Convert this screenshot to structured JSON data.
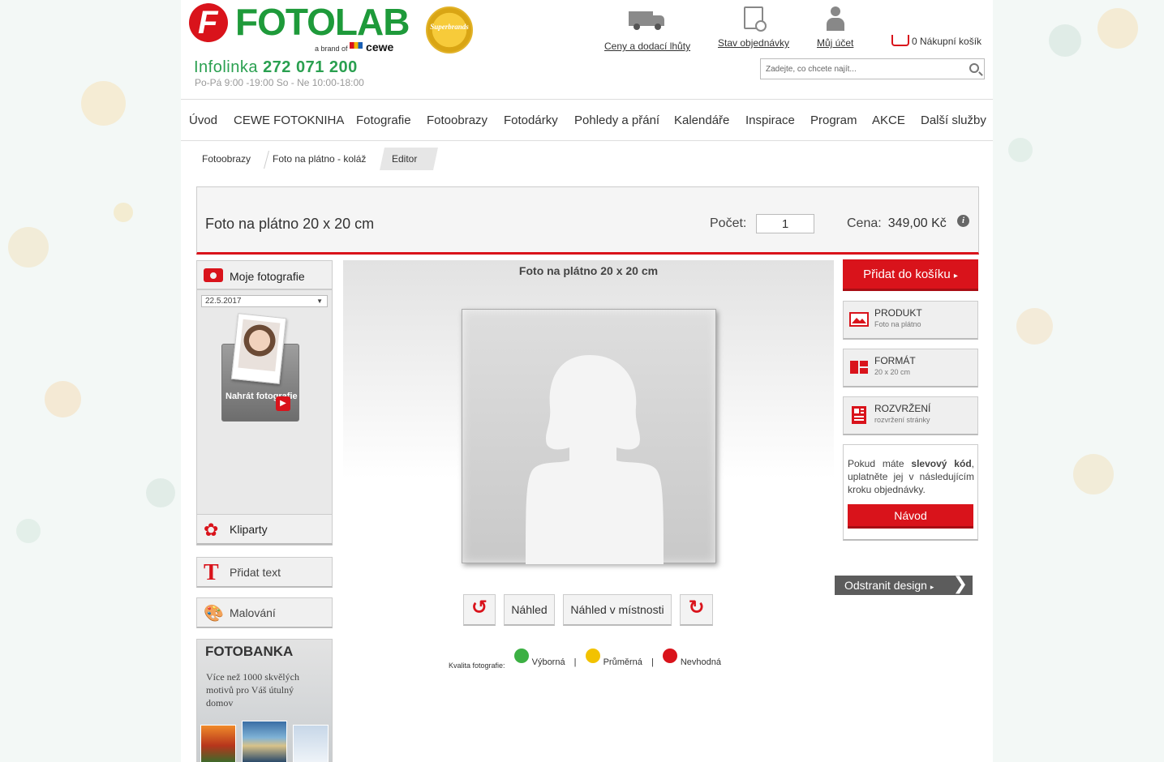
{
  "header": {
    "logo_text": "FOTOLAB",
    "logo_letter": "F",
    "brand_prefix": "a brand of",
    "brand_name": "cewe",
    "award_text": "Superbrands",
    "hotline_label": "Infolinka",
    "hotline_number": "272 071 200",
    "hours": "Po-Pá 9:00 -19:00  So - Ne 10:00-18:00",
    "links": [
      {
        "label": "Ceny a dodací lhůty",
        "icon": "truck-icon"
      },
      {
        "label": "Stav objednávky",
        "icon": "order-status-icon"
      },
      {
        "label": "Můj účet",
        "icon": "user-icon"
      }
    ],
    "cart_label": "0 Nákupní košík",
    "search_placeholder": "Zadejte, co chcete najít..."
  },
  "nav": {
    "items": [
      "Úvod",
      "CEWE FOTOKNIHA",
      "Fotografie",
      "Fotoobrazy",
      "Fotodárky",
      "Pohledy a přání",
      "Kalendáře",
      "Inspirace",
      "Program",
      "AKCE",
      "Další služby"
    ]
  },
  "breadcrumb": [
    "Fotoobrazy",
    "Foto na plátno - koláž",
    "Editor"
  ],
  "product": {
    "title": "Foto na plátno 20 x 20 cm",
    "qty_label": "Počet:",
    "qty_value": "1",
    "price_label": "Cena:",
    "price_value": "349,00 Kč"
  },
  "left_panel": {
    "photos_title": "Moje fotografie",
    "date_value": "22.5.2017",
    "upload_label": "Nahrát fotografie",
    "cliparts": "Kliparty",
    "add_text": "Přidat text",
    "painting": "Malování",
    "fotobanka_title": "FOTOBANKA",
    "fotobanka_text": "Více než 1000 skvělých motivů pro Váš útulný domov"
  },
  "canvas": {
    "title": "Foto na plátno 20 x 20 cm",
    "preview_label": "Náhled",
    "room_preview_label": "Náhled v místnosti",
    "quality_label": "Kvalita fotografie:",
    "quality_levels": [
      "Výborná",
      "Průměrná",
      "Nevhodná"
    ],
    "quality_colors": [
      "#3cb043",
      "#f2c200",
      "#d9131b"
    ]
  },
  "right_panel": {
    "add_to_cart": "Přidat do košíku",
    "options": [
      {
        "title": "PRODUKT",
        "subtitle": "Foto na plátno"
      },
      {
        "title": "FORMÁT",
        "subtitle": "20 x 20 cm"
      },
      {
        "title": "ROZVRŽENÍ",
        "subtitle": "rozvržení stránky"
      }
    ],
    "coupon_text_1": "Pokud máte",
    "coupon_text_bold": "slevový kód",
    "coupon_text_2": ", uplatněte jej v následujícím kroku objednávky.",
    "guide_button": "Návod",
    "remove_design": "Odstranit design"
  },
  "colors": {
    "accent_red": "#d9131b",
    "brand_green": "#1e9a3a"
  }
}
